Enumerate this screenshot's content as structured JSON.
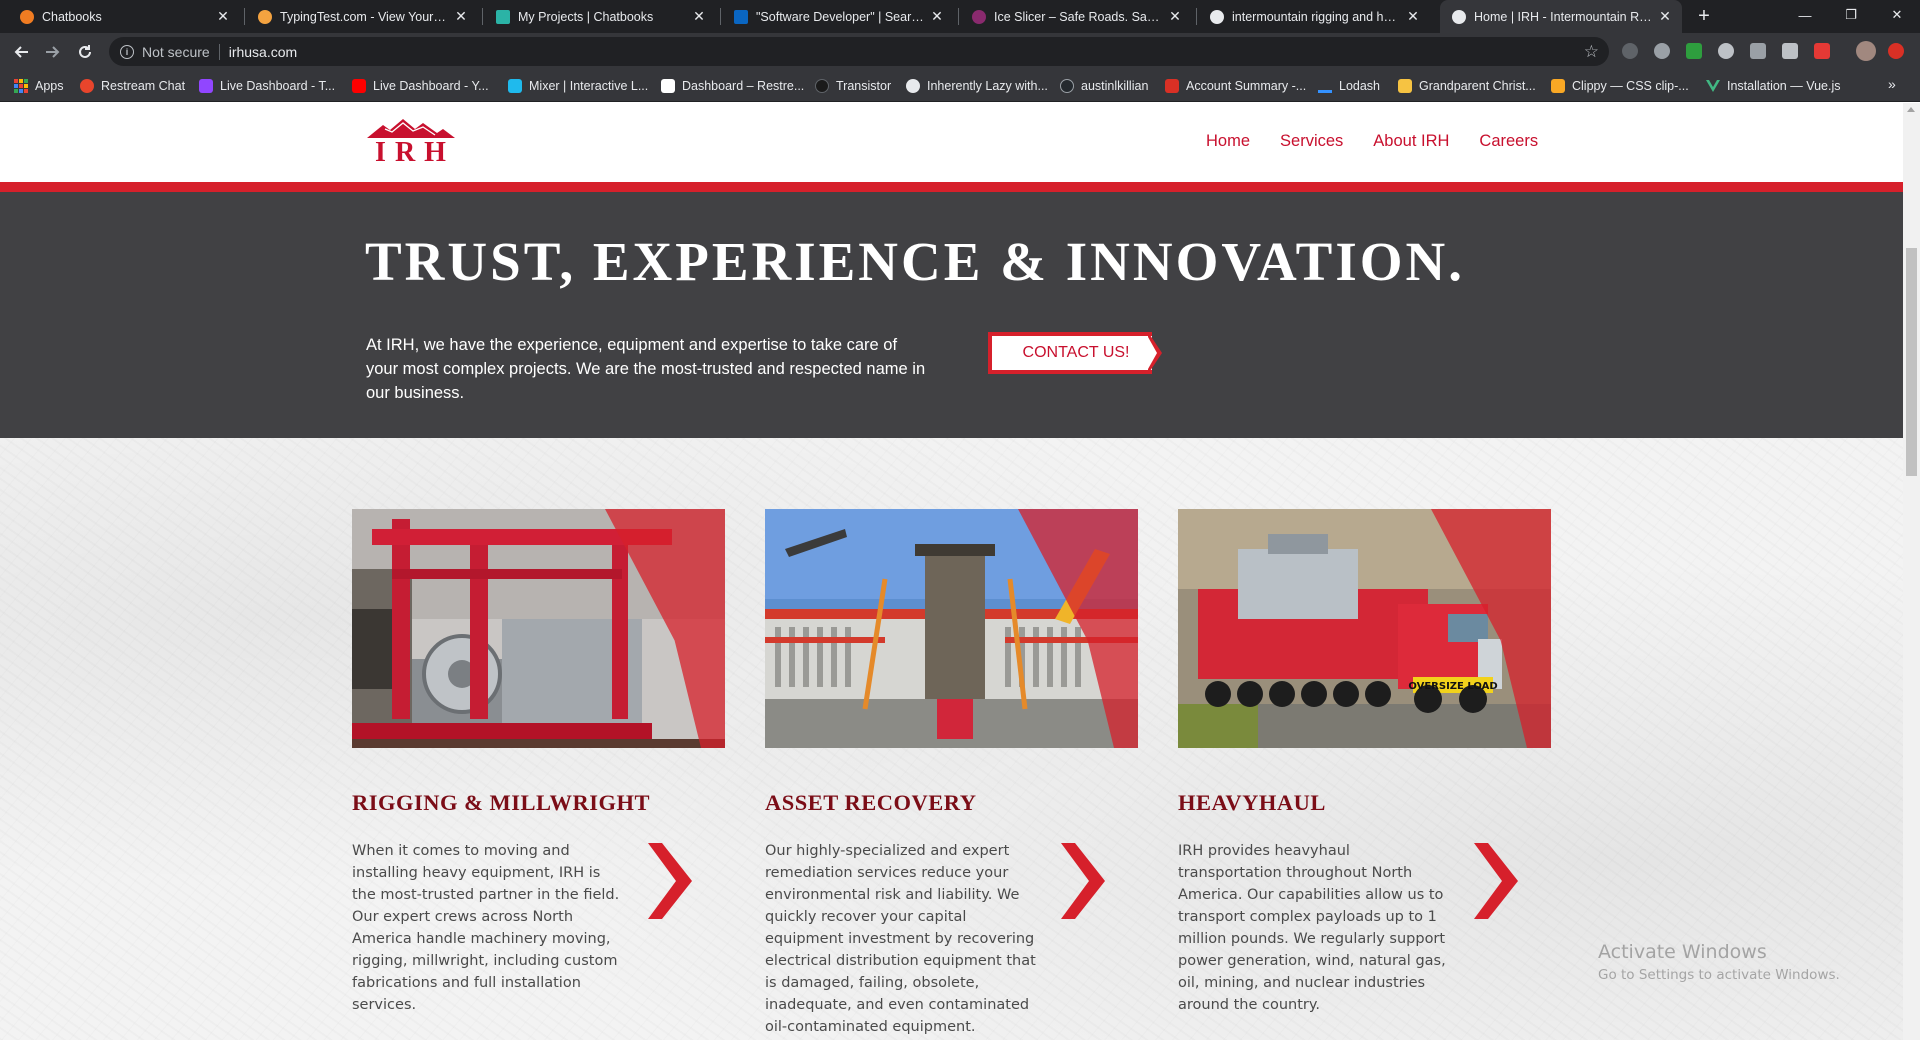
{
  "browser": {
    "tabs": [
      {
        "title": "Chatbooks",
        "favicon_color": "#f07c22"
      },
      {
        "title": "TypingTest.com - View Your Typing",
        "favicon_color": "#f4a340"
      },
      {
        "title": "My Projects | Chatbooks",
        "favicon_color": "#2bb3a6"
      },
      {
        "title": "\"Software Developer\" | Search | L",
        "favicon_color": "#0a66c2"
      },
      {
        "title": "Ice Slicer – Safe Roads. Saving Liv",
        "favicon_color": "#8a2a6e"
      },
      {
        "title": "intermountain rigging and hauling",
        "favicon_color": "#e8eaed"
      },
      {
        "title": "Home | IRH - Intermountain Rigg",
        "favicon_color": "#e8eaed",
        "active": true
      }
    ],
    "close_glyph": "✕",
    "new_tab_glyph": "+",
    "window_controls": {
      "minimize": "—",
      "restore": "❐",
      "close": "✕"
    },
    "address": {
      "security_label": "Not secure",
      "url": "irhusa.com"
    },
    "bookmarks": [
      {
        "label": "Apps",
        "icon": "apps-grid-icon"
      },
      {
        "label": "Restream Chat",
        "icon_color": "#e8452c"
      },
      {
        "label": "Live Dashboard - T...",
        "icon_color": "#9146ff"
      },
      {
        "label": "Live Dashboard - Y...",
        "icon_color": "#ff0000"
      },
      {
        "label": "Mixer | Interactive L...",
        "icon_color": "#1fbaed"
      },
      {
        "label": "Dashboard – Restre...",
        "icon_color": "#ffffff"
      },
      {
        "label": "Transistor",
        "icon_color": "#1b1b1b"
      },
      {
        "label": "Inherently Lazy with...",
        "icon_color": "#e8eaed"
      },
      {
        "label": "austinlkillian",
        "icon_color": "#24292e"
      },
      {
        "label": "Account Summary -...",
        "icon_color": "#d93025"
      },
      {
        "label": "Lodash",
        "icon_color": "#3492ff"
      },
      {
        "label": "Grandparent Christ...",
        "icon_color": "#f6c342"
      },
      {
        "label": "Clippy — CSS clip-...",
        "icon_color": "#f9a825"
      },
      {
        "label": "Installation — Vue.js",
        "icon_color": "#41b883"
      }
    ],
    "more_glyph": "»"
  },
  "site": {
    "logo_text": "IRH",
    "nav": [
      "Home",
      "Services",
      "About IRH",
      "Careers"
    ],
    "hero": {
      "title": "TRUST, EXPERIENCE & INNOVATION.",
      "text": "At IRH, we have the experience, equipment and expertise to take care of your most complex projects. We are the most-trusted and respected name in our business.",
      "cta": "CONTACT US!"
    },
    "services": [
      {
        "title": "RIGGING & MILLWRIGHT",
        "text": "When it comes to moving and installing heavy equipment, IRH is the most-trusted partner in the field. Our expert crews across North America handle machinery moving, rigging, millwright, including custom fabrications and full installation services."
      },
      {
        "title": "ASSET RECOVERY",
        "text": "Our highly-specialized and expert remediation services reduce your environmental risk and liability. We quickly recover your capital equipment investment by recovering electrical distribution equipment that is damaged, failing, obsolete, inadequate, and even contaminated oil-contaminated equipment."
      },
      {
        "title": "HEAVYHAUL",
        "text": "IRH provides heavyhaul transportation throughout North America. Our capabilities allow us to transport complex payloads up to 1 million pounds. We regularly support power generation, wind, natural gas, oil, mining, and nuclear industries around the country."
      }
    ],
    "truck_sign": "OVERSIZE LOAD"
  },
  "os_watermark": {
    "line1": "Activate Windows",
    "line2": "Go to Settings to activate Windows."
  },
  "colors": {
    "brand_red": "#d6202b",
    "heading_red": "#7b0d17",
    "hero_bg": "#414144"
  }
}
